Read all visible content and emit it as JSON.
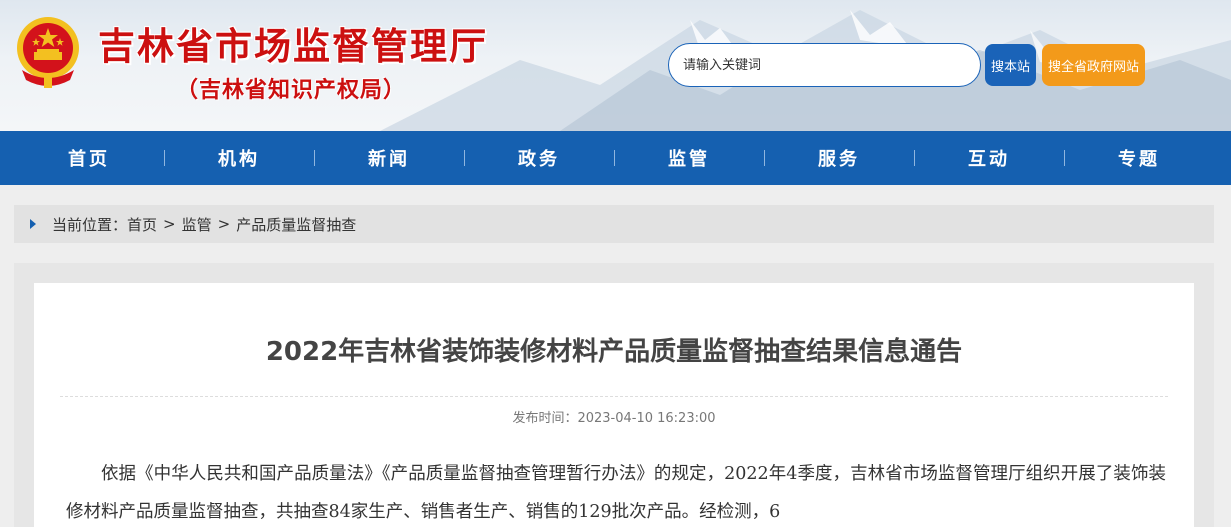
{
  "header": {
    "site_title": "吉林省市场监督管理厅",
    "site_subtitle": "（吉林省知识产权局）",
    "emblem_icon": "national-emblem-icon",
    "search_placeholder": "请输入关键词",
    "search_site_button": "搜本站",
    "search_province_button": "搜全省政府网站",
    "colors": {
      "title_red": "#cc1010",
      "brand_blue": "#1560b0",
      "orange": "#f39a1a"
    }
  },
  "nav": {
    "items": [
      {
        "label": "首页"
      },
      {
        "label": "机构"
      },
      {
        "label": "新闻"
      },
      {
        "label": "政务"
      },
      {
        "label": "监管"
      },
      {
        "label": "服务"
      },
      {
        "label": "互动"
      },
      {
        "label": "专题"
      }
    ]
  },
  "breadcrumb": {
    "prefix": "当前位置：",
    "items": [
      "首页",
      "监管",
      "产品质量监督抽查"
    ],
    "separator": ">"
  },
  "article": {
    "title": "2022年吉林省装饰装修材料产品质量监督抽查结果信息通告",
    "publish_time": "发布时间：2023-04-10 16:23:00",
    "body": "依据《中华人民共和国产品质量法》《产品质量监督抽查管理暂行办法》的规定，2022年4季度，吉林省市场监督管理厅组织开展了装饰装修材料产品质量监督抽查，共抽查84家生产、销售者生产、销售的129批次产品。经检测，6"
  }
}
